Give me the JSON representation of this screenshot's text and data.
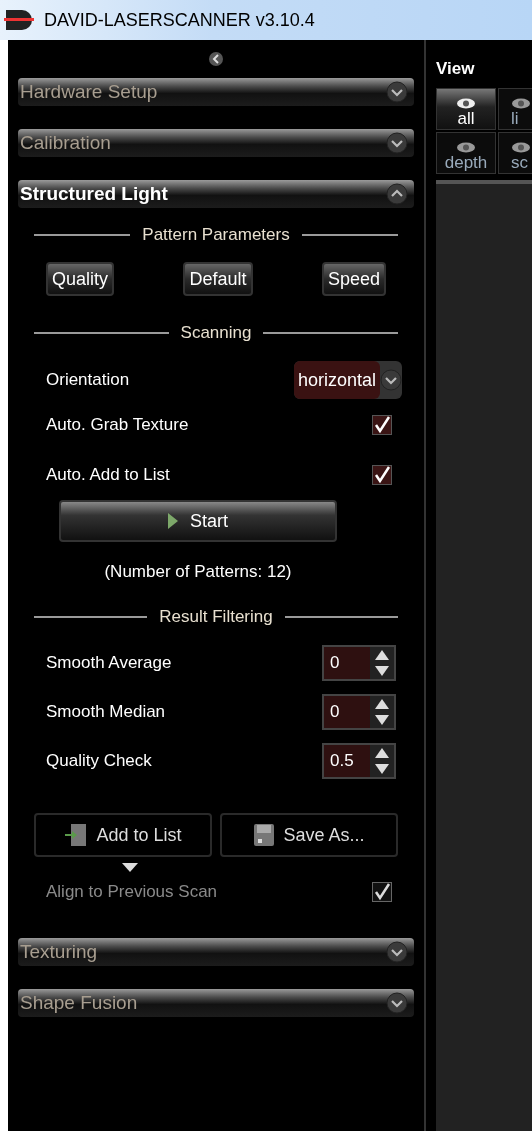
{
  "window": {
    "title": "DAVID-LASERSCANNER v3.10.4"
  },
  "sections_top": [
    {
      "title": "Hardware Setup",
      "expanded": false
    },
    {
      "title": "Calibration",
      "expanded": false
    },
    {
      "title": "Structured Light",
      "expanded": true
    }
  ],
  "structured_light": {
    "pattern_parameters": {
      "heading": "Pattern Parameters",
      "buttons": [
        "Quality",
        "Default",
        "Speed"
      ]
    },
    "scanning": {
      "heading": "Scanning",
      "orientation": {
        "label": "Orientation",
        "value": "horizontal"
      },
      "options": [
        {
          "label": "Auto. Grab Texture",
          "checked": true
        },
        {
          "label": "Auto. Add to List",
          "checked": true
        }
      ],
      "start_button": "Start",
      "pattern_count": "(Number of Patterns: 12)"
    },
    "result_filtering": {
      "heading": "Result Filtering",
      "fields": [
        {
          "label": "Smooth Average",
          "value": "0"
        },
        {
          "label": "Smooth Median",
          "value": "0"
        },
        {
          "label": "Quality Check",
          "value": "0.5"
        }
      ]
    },
    "actions": [
      "Add to List",
      "Save As..."
    ],
    "align": {
      "label": "Align to Previous Scan",
      "checked": true,
      "disabled": true
    }
  },
  "sections_bottom": [
    {
      "title": "Texturing",
      "expanded": false
    },
    {
      "title": "Shape Fusion",
      "expanded": false
    }
  ],
  "view": {
    "title": "View",
    "buttons": [
      {
        "label": "all",
        "selected": true
      },
      {
        "label": "li",
        "selected": false
      },
      {
        "label": "depth",
        "selected": false
      },
      {
        "label": "sc",
        "selected": false
      }
    ]
  }
}
